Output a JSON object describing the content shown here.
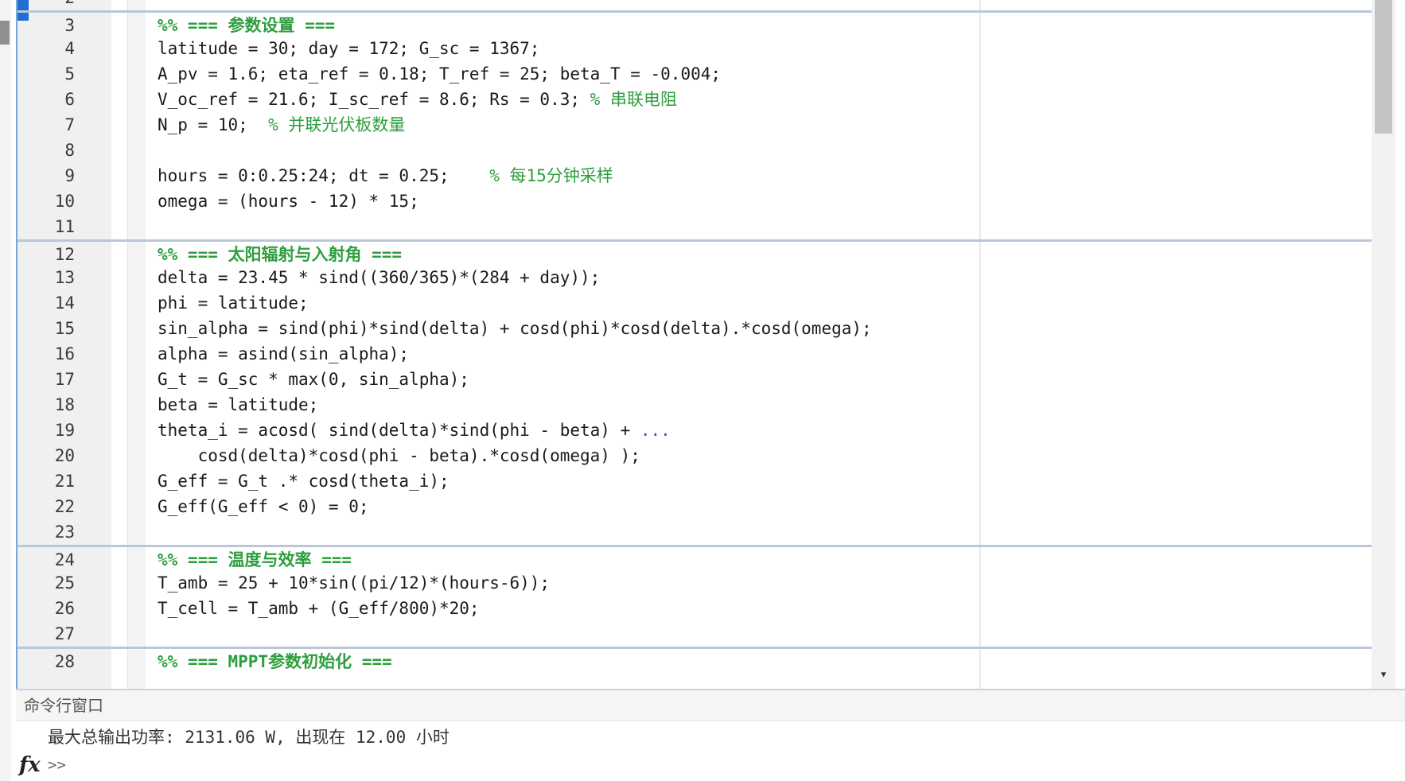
{
  "editor": {
    "lines": [
      {
        "n": "2",
        "code": "",
        "comment": ""
      },
      {
        "n": "3",
        "cell": "%% === 参数设置 ==="
      },
      {
        "n": "4",
        "code": "latitude = 30; day = 172; G_sc = 1367;",
        "comment": ""
      },
      {
        "n": "5",
        "code": "A_pv = 1.6; eta_ref = 0.18; T_ref = 25; beta_T = -0.004;",
        "comment": ""
      },
      {
        "n": "6",
        "code": "V_oc_ref = 21.6; I_sc_ref = 8.6; Rs = 0.3; ",
        "comment": "% 串联电阻"
      },
      {
        "n": "7",
        "code": "N_p = 10;  ",
        "comment": "% 并联光伏板数量"
      },
      {
        "n": "8",
        "code": "",
        "comment": ""
      },
      {
        "n": "9",
        "code": "hours = 0:0.25:24; dt = 0.25;    ",
        "comment": "% 每15分钟采样"
      },
      {
        "n": "10",
        "code": "omega = (hours - 12) * 15;",
        "comment": ""
      },
      {
        "n": "11",
        "code": "",
        "comment": ""
      },
      {
        "n": "12",
        "cell": "%% === 太阳辐射与入射角 ==="
      },
      {
        "n": "13",
        "code": "delta = 23.45 * sind((360/365)*(284 + day));",
        "comment": ""
      },
      {
        "n": "14",
        "code": "phi = latitude;",
        "comment": ""
      },
      {
        "n": "15",
        "code": "sin_alpha = sind(phi)*sind(delta) + cosd(phi)*cosd(delta).*cosd(omega);",
        "comment": ""
      },
      {
        "n": "16",
        "code": "alpha = asind(sin_alpha);",
        "comment": ""
      },
      {
        "n": "17",
        "code": "G_t = G_sc * max(0, sin_alpha);",
        "comment": ""
      },
      {
        "n": "18",
        "code": "beta = latitude;",
        "comment": ""
      },
      {
        "n": "19",
        "code": "theta_i = acosd( sind(delta)*sind(phi - beta) + ",
        "cont": "..."
      },
      {
        "n": "20",
        "code": "    cosd(delta)*cosd(phi - beta).*cosd(omega) );",
        "comment": ""
      },
      {
        "n": "21",
        "code": "G_eff = G_t .* cosd(theta_i);",
        "comment": ""
      },
      {
        "n": "22",
        "code": "G_eff(G_eff < 0) = 0;",
        "comment": ""
      },
      {
        "n": "23",
        "code": "",
        "comment": ""
      },
      {
        "n": "24",
        "cell": "%% === 温度与效率 ==="
      },
      {
        "n": "25",
        "code": "T_amb = 25 + 10*sin((pi/12)*(hours-6));",
        "comment": ""
      },
      {
        "n": "26",
        "code": "T_cell = T_amb + (G_eff/800)*20;",
        "comment": ""
      },
      {
        "n": "27",
        "code": "",
        "comment": ""
      },
      {
        "n": "28",
        "cell": "%% === MPPT参数初始化 ==="
      }
    ]
  },
  "command_window": {
    "title": "命令行窗口",
    "output": "最大总输出功率: 2131.06 W, 出现在 12.00 小时",
    "fx_icon": "fx",
    "prompt": ">>"
  },
  "scrollbar": {
    "down_arrow_icon": "▾"
  },
  "colors": {
    "comment": "#2e9e3e",
    "continuation": "#2a4fd6",
    "current_line_marker": "#1f6fd1"
  }
}
